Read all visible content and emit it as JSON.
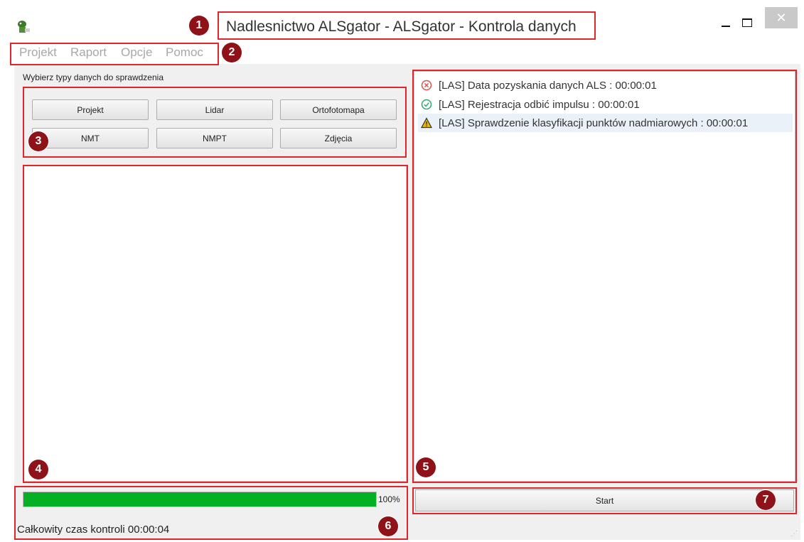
{
  "window": {
    "title": "Nadlesnictwo ALSgator - ALSgator - Kontrola danych",
    "close_glyph": "✕"
  },
  "menu": [
    "Projekt",
    "Raport",
    "Opcje",
    "Pomoc"
  ],
  "data_types": {
    "label": "Wybierz typy danych do sprawdzenia",
    "buttons": [
      "Projekt",
      "Lidar",
      "Ortofotomapa",
      "NMT",
      "NMPT",
      "Zdjęcia"
    ]
  },
  "log": [
    {
      "status": "error",
      "icon": "error-circle-icon",
      "text": "[LAS] Data pozyskania danych ALS : 00:00:01"
    },
    {
      "status": "ok",
      "icon": "check-circle-icon",
      "text": "[LAS] Rejestracja odbić impulsu : 00:00:01"
    },
    {
      "status": "warning",
      "icon": "warning-triangle-icon",
      "text": "[LAS] Sprawdzenie klasyfikacji punktów nadmiarowych : 00:00:01",
      "selected": true
    }
  ],
  "progress": {
    "value": 100,
    "label": "100%"
  },
  "total_time": "Całkowity czas kontroli 00:00:04",
  "start_label": "Start",
  "callouts": [
    "1",
    "2",
    "3",
    "4",
    "5",
    "6",
    "7"
  ],
  "colors": {
    "callout": "#e0262b",
    "badge": "#8e1218",
    "progress": "#06b025",
    "error": "#d9534f",
    "ok": "#2ea86a",
    "warning": "#e8b800"
  }
}
